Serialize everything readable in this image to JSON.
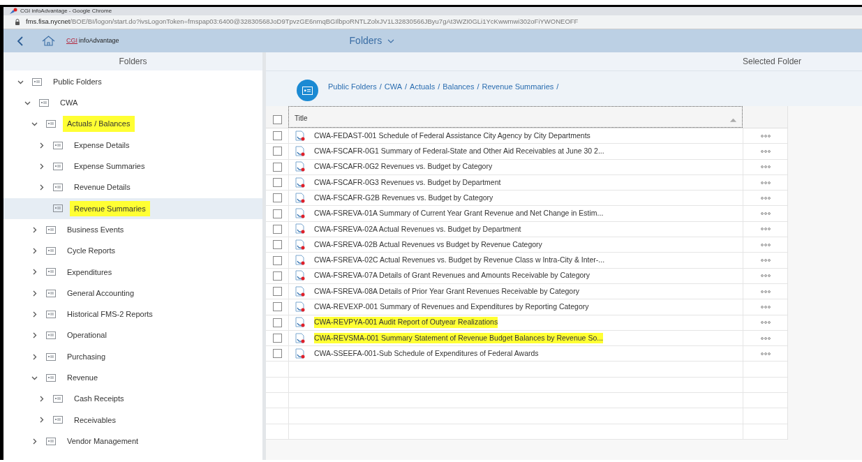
{
  "browser": {
    "title": "CGI infoAdvantage - Google Chrome",
    "url_host": "fms.fisa.nycnet",
    "url_path": "/BOE/BI/logon/start.do?ivsLogonToken=fmspap03:6400@32830568JoD9TpvzGE6nmqBGIlbpoRNTLZolxJV1L32830566JByu7gAt3WZI0GLi1YcKwwmwi302oFiYWONEOFF"
  },
  "app": {
    "logo_mark": "CGI",
    "logo_text": "infoAdvantage",
    "view_menu": "Folders"
  },
  "left_panel": {
    "title": "Folders",
    "tree": [
      {
        "label": "Public Folders",
        "kind": "folder",
        "expanded": true,
        "selected": false,
        "highlighted": false,
        "children": [
          {
            "label": "CWA",
            "kind": "folder",
            "expanded": true,
            "selected": false,
            "highlighted": false,
            "children": [
              {
                "label": "Actuals / Balances",
                "kind": "folder",
                "expanded": true,
                "selected": false,
                "highlighted": true,
                "children": [
                  {
                    "label": "Expense Details",
                    "kind": "folder",
                    "selected": false,
                    "highlighted": false
                  },
                  {
                    "label": "Expense Summaries",
                    "kind": "folder",
                    "selected": false,
                    "highlighted": false
                  },
                  {
                    "label": "Revenue Details",
                    "kind": "folder",
                    "selected": false,
                    "highlighted": false
                  },
                  {
                    "label": "Revenue Summaries",
                    "kind": "leaf",
                    "selected": true,
                    "highlighted": true
                  }
                ]
              },
              {
                "label": "Business Events",
                "kind": "folder",
                "selected": false,
                "highlighted": false
              },
              {
                "label": "Cycle Reports",
                "kind": "folder",
                "selected": false,
                "highlighted": false
              },
              {
                "label": "Expenditures",
                "kind": "folder",
                "selected": false,
                "highlighted": false
              },
              {
                "label": "General Accounting",
                "kind": "folder",
                "selected": false,
                "highlighted": false
              },
              {
                "label": "Historical FMS-2 Reports",
                "kind": "folder",
                "selected": false,
                "highlighted": false
              },
              {
                "label": "Operational",
                "kind": "folder",
                "selected": false,
                "highlighted": false
              },
              {
                "label": "Purchasing",
                "kind": "folder",
                "selected": false,
                "highlighted": false
              },
              {
                "label": "Revenue",
                "kind": "folder",
                "expanded": true,
                "selected": false,
                "highlighted": false,
                "children": [
                  {
                    "label": "Cash Receipts",
                    "kind": "folder",
                    "selected": false,
                    "highlighted": false
                  },
                  {
                    "label": "Receivables",
                    "kind": "folder",
                    "selected": false,
                    "highlighted": false
                  }
                ]
              },
              {
                "label": "Vendor Management",
                "kind": "folder",
                "selected": false,
                "highlighted": false
              }
            ]
          }
        ]
      }
    ]
  },
  "right_panel": {
    "title": "Selected Folder",
    "breadcrumb": [
      "Public Folders",
      "CWA",
      "Actuals",
      "Balances",
      "Revenue Summaries"
    ],
    "breadcrumb_separator": "/",
    "table": {
      "columns": [
        "Title"
      ],
      "select_all_checked": false,
      "rows": [
        {
          "title": "CWA-FEDAST-001 Schedule of Federal Assistance City Agency by City Departments",
          "checked": false,
          "highlighted": false
        },
        {
          "title": "CWA-FSCAFR-0G1 Summary of Federal-State and Other Aid Receivables at June 30 2...",
          "checked": false,
          "highlighted": false
        },
        {
          "title": "CWA-FSCAFR-0G2 Revenues vs. Budget by Category",
          "checked": false,
          "highlighted": false
        },
        {
          "title": "CWA-FSCAFR-0G3 Revenues vs. Budget by Department",
          "checked": false,
          "highlighted": false
        },
        {
          "title": "CWA-FSCAFR-G2B Revenues vs. Budget by Category",
          "checked": false,
          "highlighted": false
        },
        {
          "title": "CWA-FSREVA-01A Summary of Current Year Grant Revenue and Net Change in Estim...",
          "checked": false,
          "highlighted": false
        },
        {
          "title": "CWA-FSREVA-02A Actual Revenues vs. Budget by Department",
          "checked": false,
          "highlighted": false
        },
        {
          "title": "CWA-FSREVA-02B Actual Revenues vs Budget by Revenue Category",
          "checked": false,
          "highlighted": false
        },
        {
          "title": "CWA-FSREVA-02C Actual Revenues vs. Budget by Revenue Class w Intra-City & Inter-...",
          "checked": false,
          "highlighted": false
        },
        {
          "title": "CWA-FSREVA-07A Details of Grant Revenues and Amounts Receivable by Category",
          "checked": false,
          "highlighted": false
        },
        {
          "title": "CWA-FSREVA-08A Details of Prior Year Grant Revenues Receivable by Category",
          "checked": false,
          "highlighted": false
        },
        {
          "title": "CWA-REVEXP-001 Summary of Revenues and Expenditures by Reporting Category",
          "checked": false,
          "highlighted": false
        },
        {
          "title": "CWA-REVPYA-001 Audit Report of Outyear Realizations",
          "checked": false,
          "highlighted": true
        },
        {
          "title": "CWA-REVSMA-001 Summary Statement of Revenue Budget Balances by Revenue So...",
          "checked": false,
          "highlighted": true
        },
        {
          "title": "CWA-SSEEFA-001-Sub Schedule of Expenditures of Federal Awards",
          "checked": false,
          "highlighted": false
        }
      ]
    }
  }
}
